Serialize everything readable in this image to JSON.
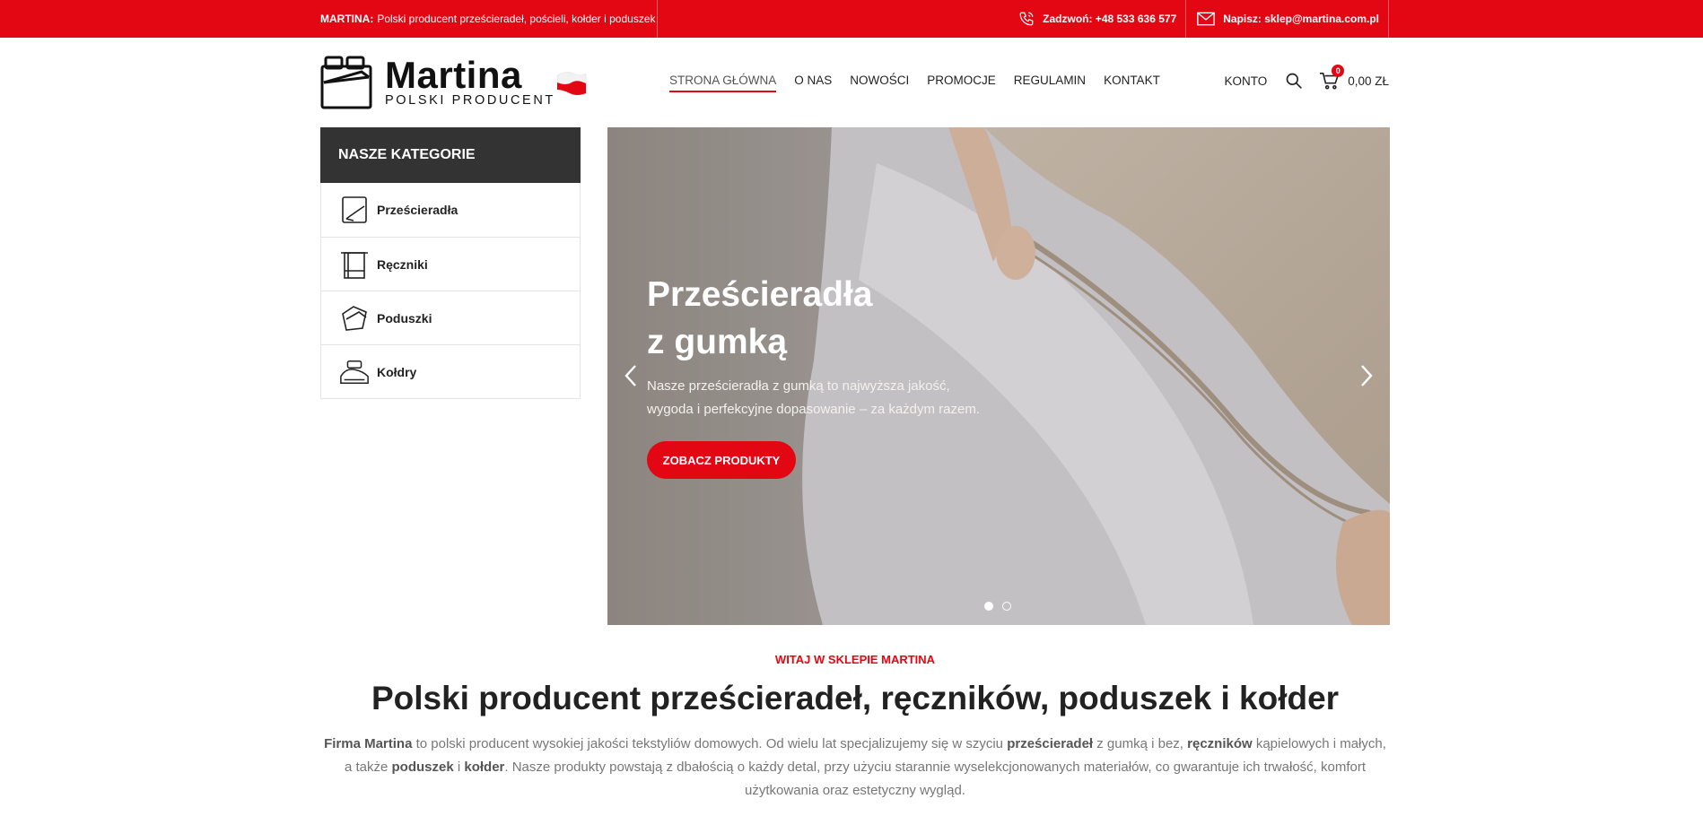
{
  "topbar": {
    "brand": "MARTINA:",
    "tagline": "Polski producent prześcieradeł, pościeli, kołder i poduszek",
    "phone_label": "Zadzwoń: +48 533 636 577",
    "email_label": "Napisz: sklep@martina.com.pl"
  },
  "logo": {
    "name": "Martina",
    "subtitle": "POLSKI PRODUCENT"
  },
  "nav": {
    "items": [
      "STRONA GŁÓWNA",
      "O NAS",
      "NOWOŚCI",
      "PROMOCJE",
      "REGULAMIN",
      "KONTAKT"
    ],
    "active": "STRONA GŁÓWNA"
  },
  "header": {
    "account_label": "KONTO",
    "cart_count": "0",
    "cart_total": "0,00 ZŁ"
  },
  "categories": {
    "title": "NASZE KATEGORIE",
    "items": [
      {
        "label": "Prześcieradła",
        "icon": "sheet-icon"
      },
      {
        "label": "Ręczniki",
        "icon": "towel-icon"
      },
      {
        "label": "Poduszki",
        "icon": "pillow-icon"
      },
      {
        "label": "Kołdry",
        "icon": "duvet-icon"
      }
    ]
  },
  "slider": {
    "title_line1": "Prześcieradła",
    "title_line2": "z gumką",
    "text_line1": "Nasze prześcieradła z gumką to najwyższa jakość,",
    "text_line2": "wygoda i perfekcyjne dopasowanie – za każdym razem.",
    "button_label": "ZOBACZ PRODUKTY",
    "slide_count": 2,
    "active_slide": 1
  },
  "intro": {
    "kicker": "WITAJ W SKLEPIE MARTINA",
    "heading": "Polski producent prześcieradeł, ręczników, poduszek i kołder",
    "p_1": "Firma Martina",
    "p_2": " to polski producent wysokiej jakości tekstyliów domowych. Od wielu lat specjalizujemy się w szyciu ",
    "p_3": "prześcieradeł",
    "p_4": " z gumką i bez, ",
    "p_5": "ręczników",
    "p_6": " kąpielowych i małych, a także ",
    "p_7": "poduszek",
    "p_8": " i ",
    "p_9": "kołder",
    "p_10": ". Nasze produkty powstają z dbałością o każdy detal, przy użyciu starannie wyselekcjonowanych materiałów, co gwarantuje ich trwałość, komfort użytkowania oraz estetyczny wygląd."
  },
  "colors": {
    "accent": "#e30613",
    "dark": "#333333",
    "text": "#222222",
    "muted": "#777777"
  }
}
